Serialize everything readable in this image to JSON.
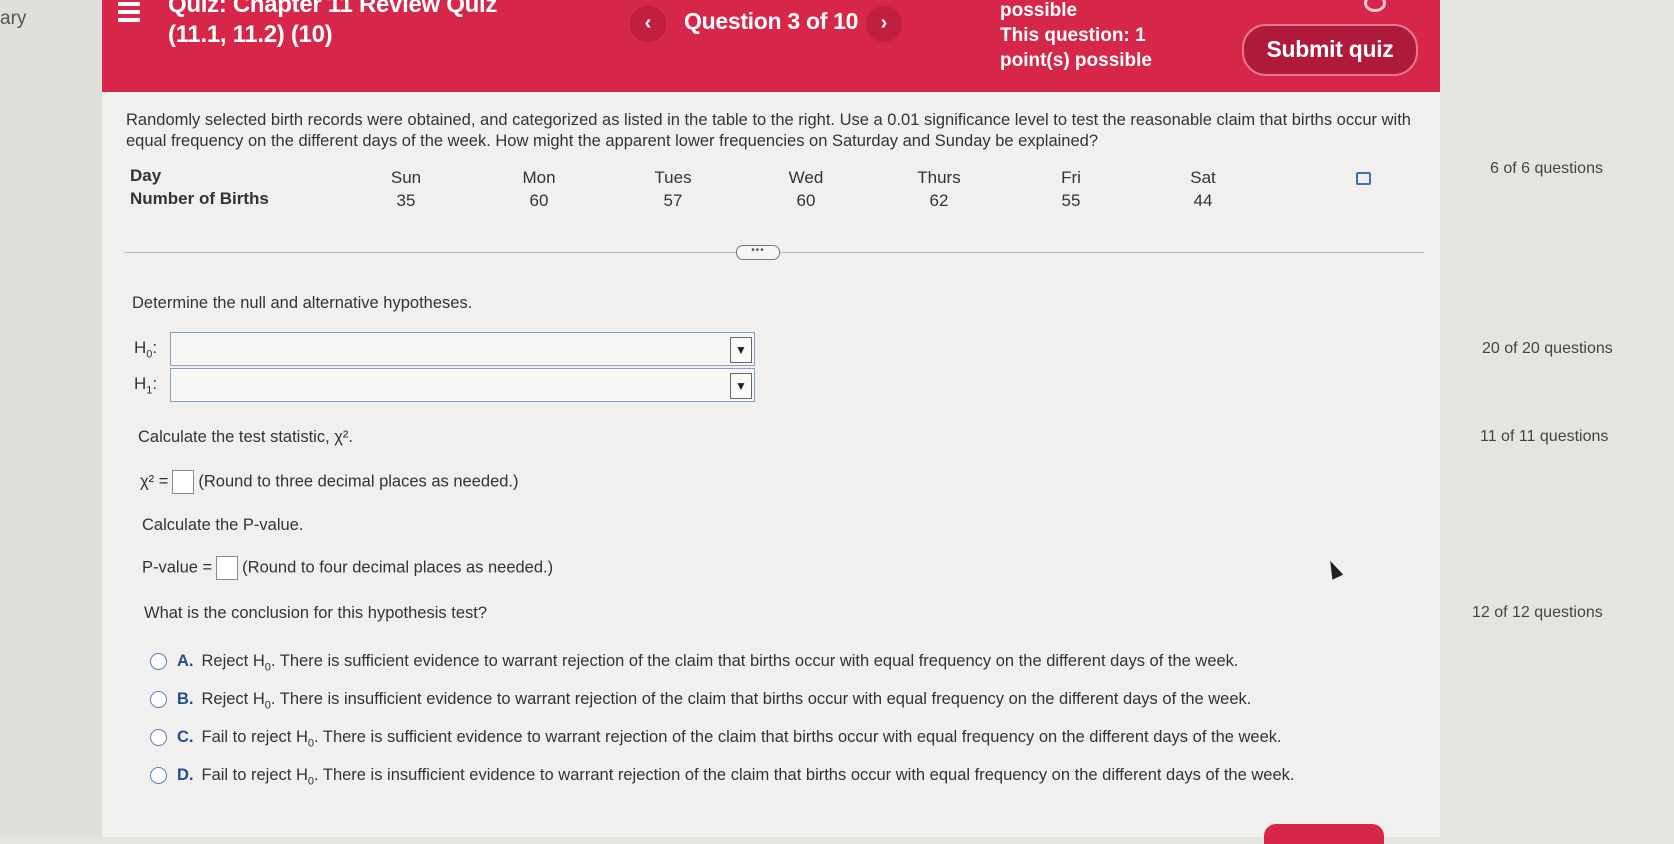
{
  "left_strip_text": "ary",
  "header": {
    "title_line1": "Quiz: Chapter 11 Review Quiz",
    "title_line2": "(11.1, 11.2) (10)",
    "question_counter": "Question 3 of 10",
    "points_line1": "possible",
    "points_line2": "This question: 1",
    "points_line3": "point(s) possible",
    "submit_label": "Submit quiz",
    "prev_label": "‹",
    "next_label": "›"
  },
  "problem": {
    "text": "Randomly selected birth records were obtained, and categorized as listed in the table to the right. Use a 0.01 significance level to test the reasonable claim that births occur with equal frequency on the different days of the week. How might the apparent lower frequencies on Saturday and Sunday be explained?",
    "table": {
      "row1_label": "Day",
      "row2_label": "Number of Births",
      "days": [
        "Sun",
        "Mon",
        "Tues",
        "Wed",
        "Thurs",
        "Fri",
        "Sat"
      ],
      "births": [
        "35",
        "60",
        "57",
        "60",
        "62",
        "55",
        "44"
      ]
    }
  },
  "hypotheses": {
    "prompt": "Determine the null and alternative hypotheses.",
    "h0_label": "H",
    "h0_sub": "0",
    "h1_label": "H",
    "h1_sub": "1"
  },
  "test_stat": {
    "prompt": "Calculate the test statistic, χ².",
    "label": "χ² =",
    "hint": "(Round to three decimal places as needed.)"
  },
  "p_value": {
    "prompt": "Calculate the P-value.",
    "label": "P-value =",
    "hint": "(Round to four decimal places as needed.)"
  },
  "conclusion": {
    "prompt": "What is the conclusion for this hypothesis test?",
    "options": [
      {
        "letter": "A.",
        "prefix": "Reject H",
        "sub": "0",
        "text": ". There is sufficient evidence to warrant rejection of the claim that births occur with equal frequency on the different days of the week."
      },
      {
        "letter": "B.",
        "prefix": "Reject H",
        "sub": "0",
        "text": ". There is insufficient evidence to warrant rejection of the claim that births occur with equal frequency on the different days of the week."
      },
      {
        "letter": "C.",
        "prefix": "Fail to reject H",
        "sub": "0",
        "text": ". There is sufficient evidence to warrant rejection of the claim that births occur with equal frequency on the different days of the week."
      },
      {
        "letter": "D.",
        "prefix": "Fail to reject H",
        "sub": "0",
        "text": ". There is insufficient evidence to warrant rejection of the claim that births occur with equal frequency on the different days of the week."
      }
    ]
  },
  "right_panel": [
    "6 of 6 questions",
    "20 of 20 questions",
    "11 of 11 questions",
    "12 of 12 questions"
  ],
  "colors": {
    "header": "#d6274a",
    "submit": "#b01a3a",
    "page": "#f1f0ee"
  }
}
